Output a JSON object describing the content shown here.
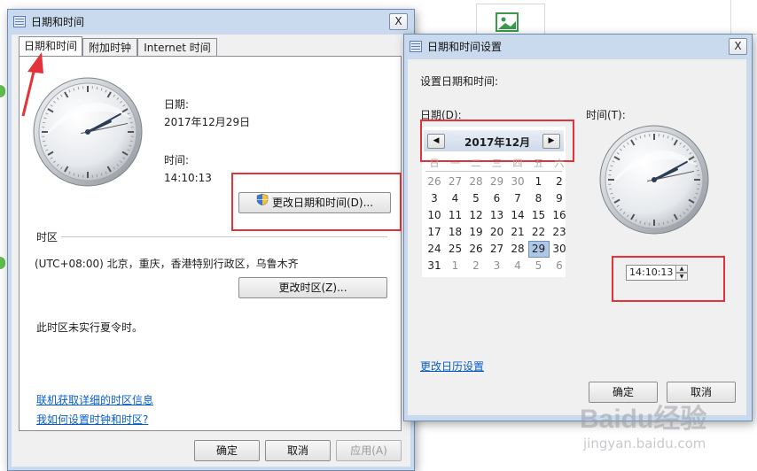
{
  "left_window": {
    "title": "日期和时间",
    "close_label": "X",
    "tabs": [
      {
        "label": "日期和时间"
      },
      {
        "label": "附加时钟"
      },
      {
        "label": "Internet 时间"
      }
    ],
    "date_label": "日期:",
    "date_value": "2017年12月29日",
    "time_label": "时间:",
    "time_value": "14:10:13",
    "change_datetime_button": "更改日期和时间(D)...",
    "timezone_group_label": "时区",
    "timezone_value": "(UTC+08:00) 北京，重庆，香港特别行政区，乌鲁木齐",
    "change_timezone_button": "更改时区(Z)...",
    "dst_text": "此时区未实行夏令时。",
    "link_online": "联机获取详细的时区信息",
    "link_howto": "我如何设置时钟和时区?",
    "ok_button": "确定",
    "cancel_button": "取消",
    "apply_button": "应用(A)"
  },
  "right_window": {
    "title": "日期和时间设置",
    "close_label": "X",
    "heading": "设置日期和时间:",
    "date_label": "日期(D):",
    "time_label": "时间(T):",
    "calendar": {
      "month_title": "2017年12月",
      "prev_glyph": "◀",
      "next_glyph": "▶",
      "weekdays": [
        "日",
        "一",
        "二",
        "三",
        "四",
        "五",
        "六"
      ],
      "days": [
        [
          "26",
          "27",
          "28",
          "29",
          "30",
          "1",
          "2"
        ],
        [
          "3",
          "4",
          "5",
          "6",
          "7",
          "8",
          "9"
        ],
        [
          "10",
          "11",
          "12",
          "13",
          "14",
          "15",
          "16"
        ],
        [
          "17",
          "18",
          "19",
          "20",
          "21",
          "22",
          "23"
        ],
        [
          "24",
          "25",
          "26",
          "27",
          "28",
          "29",
          "30"
        ],
        [
          "31",
          "1",
          "2",
          "3",
          "4",
          "5",
          "6"
        ]
      ],
      "selected_day": "29"
    },
    "time_input_value": "14:10:13",
    "change_calendar_link": "更改日历设置",
    "ok_button": "确定",
    "cancel_button": "取消"
  },
  "clock": {
    "hour": 14,
    "minute": 10,
    "second": 13
  },
  "watermark": {
    "brand": "Baidu经验",
    "url": "jingyan.baidu.com"
  },
  "colors": {
    "highlight_box": "#e53238",
    "link": "#0a5ec8",
    "selected_day": "#aec7e6"
  }
}
